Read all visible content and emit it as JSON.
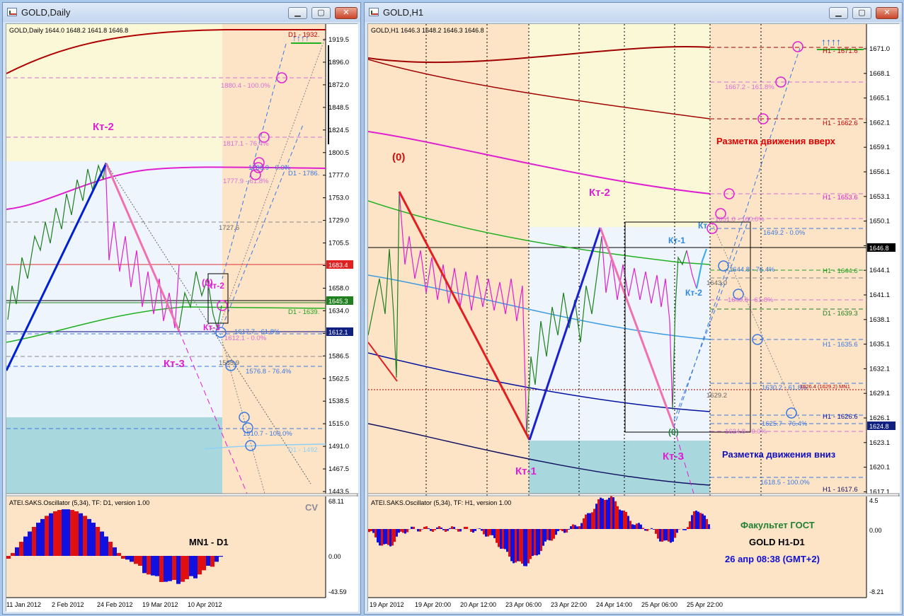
{
  "windows": [
    {
      "title": "GOLD,Daily",
      "info": "GOLD,Daily  1644.0 1648.2 1641.8 1646.8",
      "y_axis": [
        "1919.5",
        "1896.0",
        "1872.0",
        "1848.5",
        "1824.5",
        "1800.5",
        "1777.0",
        "1753.0",
        "1729.0",
        "1705.5",
        "1681.5",
        "1658.0",
        "1634.0",
        "1610.5",
        "1586.5",
        "1562.5",
        "1538.5",
        "1515.0",
        "1491.0",
        "1467.5",
        "1443.5"
      ],
      "price_tags": {
        "p1": "1683.4",
        "p2": "1645.3",
        "p3": "1612.1"
      },
      "x_axis": [
        "11 Jan 2012",
        "2 Feb 2012",
        "24 Feb 2012",
        "19 Mar 2012",
        "10 Apr 2012"
      ],
      "labels": {
        "kt2": "Кт-2",
        "kt3": "Кт-3",
        "zero": "(0)",
        "kt2b": "Кт-2",
        "kt3b": "Кт-3",
        "d1_1932": "D1 - 1932.",
        "d1_1786": "D1 - 1786.",
        "d1_1639": "D1 - 1639.",
        "d1_1492": "D1 - 1492.",
        "f1880": "1880.4 - 100.0%",
        "f1817": "1817.1 - 76.4%",
        "f1786": "1786.9 - 0.0%",
        "f1777": "1777.9 - 61.8%",
        "f1727": "1727.6",
        "f1617": "1617.7 - 61.8%",
        "f1612": "1612.1 - 0.0%",
        "f1585": "1585.9",
        "f1576": "1576.8 - 76.4%",
        "f1510": "1510.7 - 100.0%",
        "arrows": "↑↑↑↑"
      },
      "osc": {
        "title": "ATEI.SAKS.Oscillator (5,34), TF: D1, version 1.00",
        "ticks": [
          "68.11",
          "0.00",
          "-43.59"
        ],
        "label": "MN1 - D1",
        "cv": "CV"
      }
    },
    {
      "title": "GOLD,H1",
      "info": "GOLD,H1  1646.3 1648.2 1646.3 1646.8",
      "y_axis": [
        "1671.0",
        "1668.1",
        "1665.1",
        "1662.1",
        "1659.1",
        "1656.1",
        "1653.1",
        "1650.1",
        "1647.1",
        "1644.1",
        "1641.1",
        "1638.1",
        "1635.1",
        "1632.1",
        "1629.1",
        "1626.1",
        "1623.1",
        "1620.1",
        "1617.1"
      ],
      "price_tags": {
        "p1": "1646.8",
        "p2": "1624.8"
      },
      "x_axis": [
        "19 Apr 2012",
        "19 Apr 20:00",
        "20 Apr 12:00",
        "23 Apr 06:00",
        "23 Apr 22:00",
        "24 Apr 14:00",
        "25 Apr 06:00",
        "25 Apr 22:00"
      ],
      "labels": {
        "zero_top": "(0)",
        "kt2": "Кт-2",
        "kt1": "Кт-1",
        "kt1b": "Кт-1",
        "kt2b": "Кт-2",
        "kt3": "Кт-3",
        "zero_bot": "(0)",
        "kt_partial": "Кт",
        "up_title": "Разметка движения вверх",
        "down_title": "Разметка движения вниз",
        "h1_1671": "H1 - 1671.6",
        "h1_1662": "H1 - 1662.6",
        "h1_1653": "H1 - 1653.6",
        "h1_1644": "H1 - 1644.6",
        "d1_1639": "D1 - 1639.3",
        "h1_1635": "H1 - 1635.6",
        "h1_1626": "H1 - 1626.6",
        "h1_1617": "H1 - 1617.6",
        "f1667": "1667.2 - 161.8%",
        "f1651": "1651.0 - 100.0%",
        "f1649": "1649.2 - 0.0%",
        "f1644": "1644.8 - 76.4%",
        "f1643": "1643.0",
        "f1640": "1640.0 - 61.8%",
        "f1630": "1630.2 - 61.8%",
        "mn1": "1626.4 (1629.2) MN1",
        "f1629": "1629.2",
        "f1625": "1625.7 - 76.4%",
        "f1624": "1624.8 - 0.0%",
        "f1618": "1618.5 - 100.0%",
        "arrows": "↑↑↑↑"
      },
      "osc": {
        "title": "ATEI.SAKS.Oscillator (5,34), TF: H1, version 1.00",
        "ticks": [
          "4.5",
          "0.00",
          "-8.21"
        ],
        "line1": "Факультет ГОСТ",
        "line2": "GOLD   H1-D1",
        "line3": "26 апр 08:38  (GMT+2)"
      }
    }
  ],
  "chart_data": [
    {
      "type": "line",
      "title": "GOLD,Daily",
      "series": [
        {
          "name": "GOLD,Daily",
          "values": [
            1646.8
          ]
        }
      ],
      "ylim": [
        1443.5,
        1932.0
      ],
      "last_price": 1646.8,
      "ohlc": [
        1644.0,
        1648.2,
        1641.8,
        1646.8
      ],
      "levels": [
        1932.0,
        1880.4,
        1817.1,
        1786.9,
        1777.9,
        1727.6,
        1683.4,
        1645.3,
        1639.0,
        1617.7,
        1612.1,
        1585.9,
        1576.8,
        1510.7,
        1492.0
      ],
      "grid": false
    },
    {
      "type": "line",
      "title": "GOLD,H1",
      "series": [
        {
          "name": "GOLD,H1",
          "values": [
            1646.8
          ]
        }
      ],
      "ylim": [
        1617.1,
        1671.6
      ],
      "last_price": 1646.8,
      "ohlc": [
        1646.3,
        1648.2,
        1646.3,
        1646.8
      ],
      "levels": [
        1671.6,
        1667.2,
        1662.6,
        1653.6,
        1651.0,
        1649.2,
        1646.8,
        1644.8,
        1644.6,
        1643.0,
        1640.0,
        1639.3,
        1635.6,
        1630.2,
        1629.2,
        1626.6,
        1625.7,
        1624.8,
        1618.5,
        1617.6
      ],
      "grid": true
    }
  ],
  "colors": {
    "pink": "#e020d0",
    "blue": "#3c78e0",
    "green": "#20b020",
    "darkred": "#a00000",
    "navy": "#101080"
  }
}
